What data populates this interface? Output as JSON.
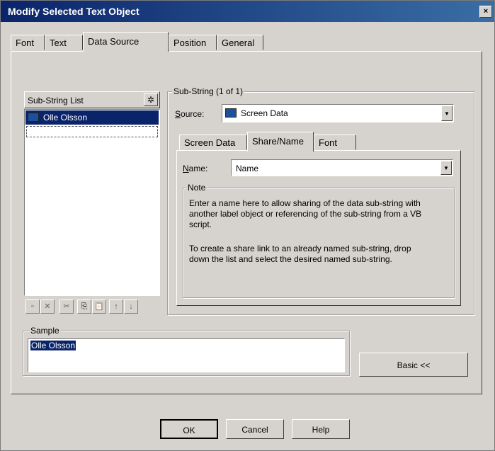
{
  "window": {
    "title": "Modify Selected Text Object",
    "close_glyph": "×"
  },
  "tabs": [
    {
      "label": "Font"
    },
    {
      "label": "Text"
    },
    {
      "label": "Data Source"
    },
    {
      "label": "Position"
    },
    {
      "label": "General"
    }
  ],
  "substring_list": {
    "label": "Sub-String List",
    "wizard_icon": "wand-icon",
    "items": [
      {
        "label": "Olle Olsson",
        "icon": "monitor-icon",
        "selected": true
      }
    ],
    "toolbar": [
      "new-icon",
      "delete-icon",
      "cut-icon",
      "copy-icon",
      "paste-icon",
      "up-arrow-icon",
      "down-arrow-icon"
    ],
    "toolbar_glyphs": [
      "▫",
      "✕",
      "✂",
      "⎘",
      "📋",
      "↑",
      "↓"
    ]
  },
  "substring_group": {
    "label": "Sub-String (1 of 1)",
    "source_label": "Source:",
    "source_value": "Screen Data",
    "inner_tabs": [
      {
        "label": "Screen Data"
      },
      {
        "label": "Share/Name"
      },
      {
        "label": "Font"
      }
    ],
    "name_label": "Name:",
    "name_value": "Name",
    "note": {
      "label": "Note",
      "para1": "Enter a name here to allow sharing of the data sub-string with another label object or referencing of the sub-string from a VB script.",
      "para2": "To create a share link to an already named sub-string, drop down the list and select the desired named sub-string."
    }
  },
  "sample": {
    "label": "Sample",
    "value": "Olle Olsson"
  },
  "basic_button": "Basic <<",
  "footer": {
    "ok": "OK",
    "cancel": "Cancel",
    "help": "Help"
  }
}
